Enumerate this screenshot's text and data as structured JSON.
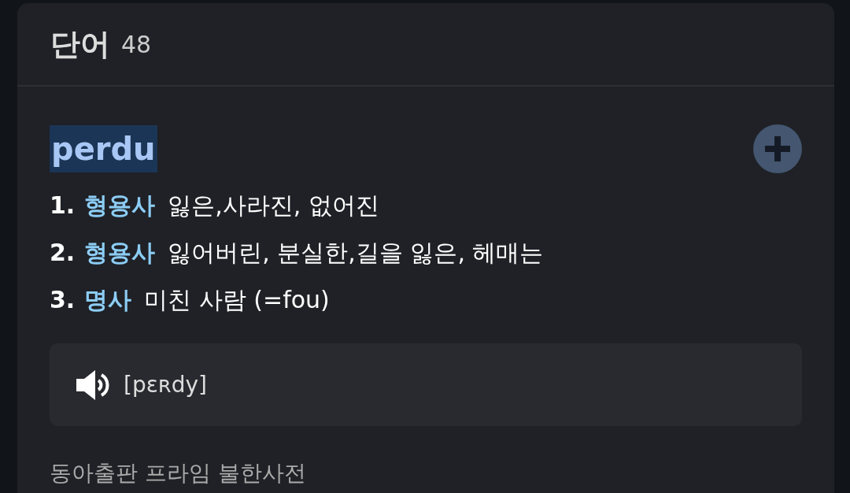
{
  "header": {
    "title": "단어",
    "count": "48"
  },
  "entry": {
    "word": "perdu",
    "highlighted": true,
    "senses": [
      {
        "number": "1.",
        "pos": "형용사",
        "meaning": "잃은,사라진, 없어진"
      },
      {
        "number": "2.",
        "pos": "형용사",
        "meaning": "잃어버린, 분실한,길을 잃은, 헤매는"
      },
      {
        "number": "3.",
        "pos": "명사",
        "meaning": "미친 사람 (=fou)"
      }
    ],
    "pronunciation": "[pɛʀdy]"
  },
  "source": "동아출판 프라임 불한사전"
}
